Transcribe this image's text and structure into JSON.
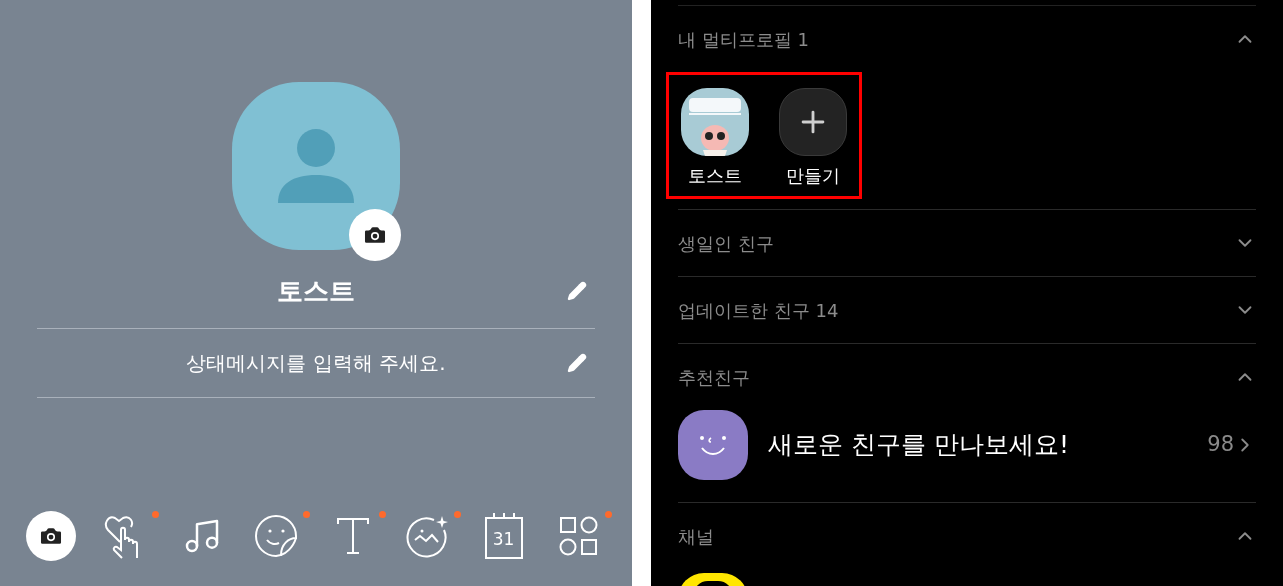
{
  "profile_editor": {
    "name": "토스트",
    "status_placeholder": "상태메시지를 입력해 주세요.",
    "toolbar": [
      {
        "kind": "camera",
        "selected": true,
        "badge": false
      },
      {
        "kind": "heart-touch",
        "selected": false,
        "badge": true
      },
      {
        "kind": "music",
        "selected": false,
        "badge": false
      },
      {
        "kind": "sticker",
        "selected": false,
        "badge": true
      },
      {
        "kind": "text",
        "selected": false,
        "badge": true
      },
      {
        "kind": "image-effect",
        "selected": false,
        "badge": true
      },
      {
        "kind": "calendar",
        "selected": false,
        "badge": false,
        "label": "31"
      },
      {
        "kind": "widgets",
        "selected": false,
        "badge": true
      }
    ]
  },
  "friends_list": {
    "sections": [
      {
        "title": "내 멀티프로필 1",
        "expanded": true,
        "highlighted": true,
        "items": [
          {
            "kind": "profile",
            "name": "토스트"
          },
          {
            "kind": "create",
            "name": "만들기"
          }
        ]
      },
      {
        "title": "생일인 친구",
        "expanded": false
      },
      {
        "title": "업데이트한 친구 14",
        "expanded": false
      },
      {
        "title": "추천친구",
        "expanded": true,
        "highlighted": false,
        "items": [
          {
            "kind": "recommend",
            "text": "새로운 친구를 만나보세요!",
            "count": "98"
          }
        ]
      },
      {
        "title": "채널",
        "expanded": true,
        "highlighted": false,
        "items": [
          {
            "kind": "channel"
          }
        ]
      }
    ]
  }
}
